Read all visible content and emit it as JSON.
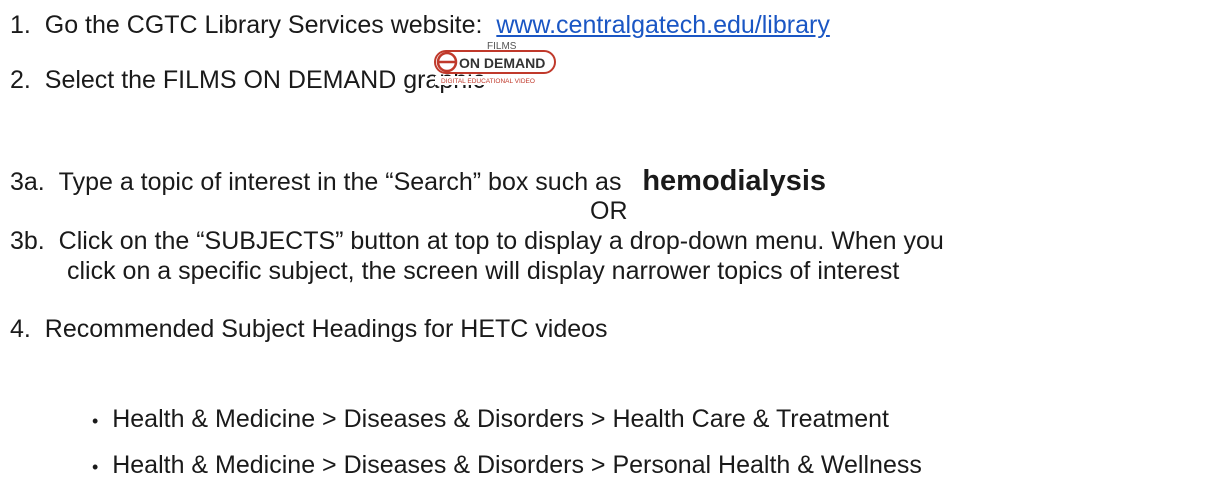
{
  "steps": {
    "s1": {
      "num": "1.",
      "text": "Go the CGTC Library Services website:",
      "link": "www.centralgatech.edu/library"
    },
    "s2": {
      "num": "2.",
      "text": "Select the FILMS ON DEMAND graphic"
    },
    "s3a": {
      "num": "3a.",
      "text": "Type a topic of interest in the “Search” box such as",
      "keyword": "hemodialysis"
    },
    "or": "OR",
    "s3b": {
      "num": "3b.",
      "line1": "Click on the “SUBJECTS” button at top to display a drop-down menu. When you",
      "line2": "click on a specific subject, the screen will display narrower topics of interest"
    },
    "s4": {
      "num": "4.",
      "text": "Recommended Subject Headings for HETC videos"
    }
  },
  "logo": {
    "top": "FILMS",
    "main": "ON DEMAND",
    "sub": "DIGITAL EDUCATIONAL VIDEO"
  },
  "bullets": [
    "Health & Medicine > Diseases & Disorders > Health Care & Treatment",
    "Health & Medicine > Diseases & Disorders > Personal Health & Wellness"
  ]
}
